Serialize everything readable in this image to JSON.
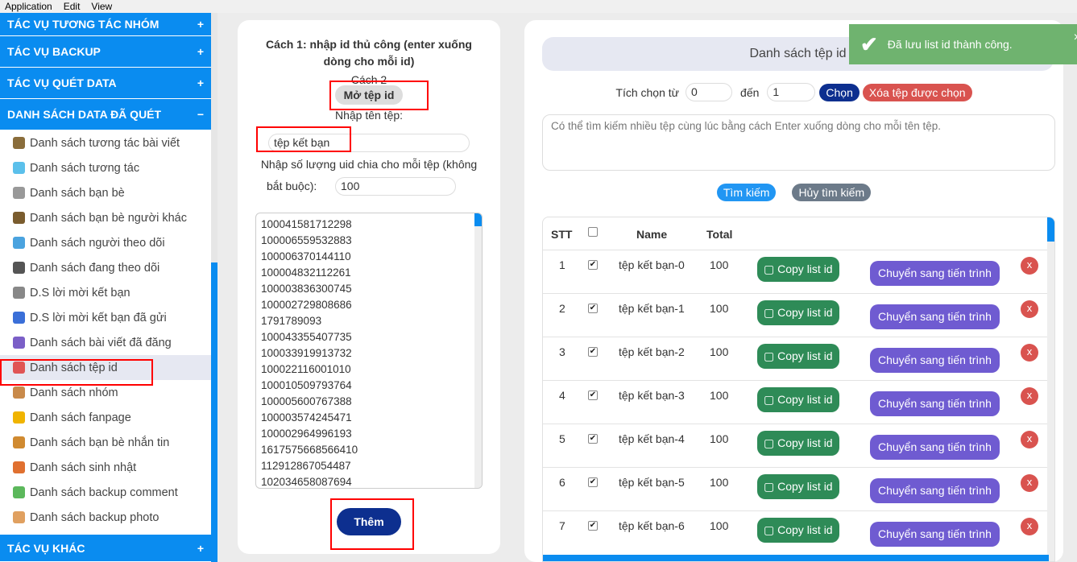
{
  "menubar": [
    "Application",
    "Edit",
    "View"
  ],
  "sidebar": {
    "headers": [
      {
        "label": "TÁC VỤ TƯƠNG TÁC NHÓM",
        "sign": "+"
      },
      {
        "label": "TÁC VỤ BACKUP",
        "sign": "+"
      },
      {
        "label": "TÁC VỤ QUÉT DATA",
        "sign": "+"
      },
      {
        "label": "DANH SÁCH DATA ĐÃ QUÉT",
        "sign": "−"
      }
    ],
    "items": [
      {
        "label": "Danh sách tương tác bài viết",
        "color": "#8a6d3b"
      },
      {
        "label": "Danh sách tương tác",
        "color": "#5bc0eb"
      },
      {
        "label": "Danh sách bạn bè",
        "color": "#999999"
      },
      {
        "label": "Danh sách bạn bè người khác",
        "color": "#7a5c2e"
      },
      {
        "label": "Danh sách người theo dõi",
        "color": "#4aa3df"
      },
      {
        "label": "Danh sách đang theo dõi",
        "color": "#555555"
      },
      {
        "label": "D.S lời mời kết bạn",
        "color": "#888888"
      },
      {
        "label": "D.S lời mời kết bạn đã gửi",
        "color": "#3a6fd8"
      },
      {
        "label": "Danh sách bài viết đã đăng",
        "color": "#7b5fc7"
      },
      {
        "label": "Danh sách tệp id",
        "color": "#e05555"
      },
      {
        "label": "Danh sách nhóm",
        "color": "#c98a4a"
      },
      {
        "label": "Danh sách fanpage",
        "color": "#f0b400"
      },
      {
        "label": "Danh sách bạn bè nhắn tin",
        "color": "#d08a30"
      },
      {
        "label": "Danh sách sinh nhật",
        "color": "#e07030"
      },
      {
        "label": "Danh sách backup comment",
        "color": "#5cb85c"
      },
      {
        "label": "Danh sách backup photo",
        "color": "#e0a060"
      }
    ],
    "active_index": 9,
    "footer": {
      "label": "TÁC VỤ KHÁC",
      "sign": "+"
    }
  },
  "mid": {
    "method1": "Cách 1: nhập id thủ công (enter xuống dòng cho mỗi id)",
    "method2": "Cách 2",
    "open_button": "Mở tệp id",
    "filename_label": "Nhập tên tệp:",
    "filename_value": "tệp kết bạn",
    "split_label_1": "Nhập số lượng uid chia cho mỗi tệp (không",
    "split_label_2": "bắt buộc):",
    "split_value": "100",
    "ids": [
      "100041581712298",
      "100006559532883",
      "100006370144110",
      "100004832112261",
      "100003836300745",
      "100002729808686",
      "1791789093",
      "100043355407735",
      "100033919913732",
      "100022116001010",
      "100010509793764",
      "100005600767388",
      "100003574245471",
      "100002964996193",
      "1617575668566410",
      "112912867054487",
      "102034658087694"
    ],
    "add_button": "Thêm"
  },
  "right": {
    "title": "Danh sách tệp id",
    "select_from_label": "Tích chọn từ",
    "from_value": "0",
    "to_label": "đến",
    "to_value": "1",
    "select_button": "Chọn",
    "delete_button": "Xóa tệp được chọn",
    "search_placeholder": "Có thể tìm kiếm nhiều tệp cùng lúc bằng cách Enter xuống dòng cho mỗi tên tệp.",
    "search_button": "Tìm kiếm",
    "cancel_search_button": "Hủy tìm kiếm",
    "table": {
      "headers": {
        "stt": "STT",
        "name": "Name",
        "total": "Total"
      },
      "copy_label": "Copy list id",
      "move_label": "Chuyển sang tiến trình",
      "delete_label": "x",
      "rows": [
        {
          "stt": "1",
          "name": "tệp kết bạn-0",
          "total": "100",
          "checked": true
        },
        {
          "stt": "2",
          "name": "tệp kết bạn-1",
          "total": "100",
          "checked": true
        },
        {
          "stt": "3",
          "name": "tệp kết bạn-2",
          "total": "100",
          "checked": true
        },
        {
          "stt": "4",
          "name": "tệp kết bạn-3",
          "total": "100",
          "checked": true
        },
        {
          "stt": "5",
          "name": "tệp kết bạn-4",
          "total": "100",
          "checked": true
        },
        {
          "stt": "6",
          "name": "tệp kết bạn-5",
          "total": "100",
          "checked": true
        },
        {
          "stt": "7",
          "name": "tệp kết bạn-6",
          "total": "100",
          "checked": true
        }
      ]
    }
  },
  "toast": {
    "message": "Đã lưu list id thành công.",
    "close": "×"
  },
  "colors": {
    "primary": "#0a8cf0",
    "navy": "#0d2f8f",
    "danger": "#d9534f",
    "success": "#2e8b57",
    "purple": "#6f5bd1",
    "toast": "#6fb36f"
  }
}
